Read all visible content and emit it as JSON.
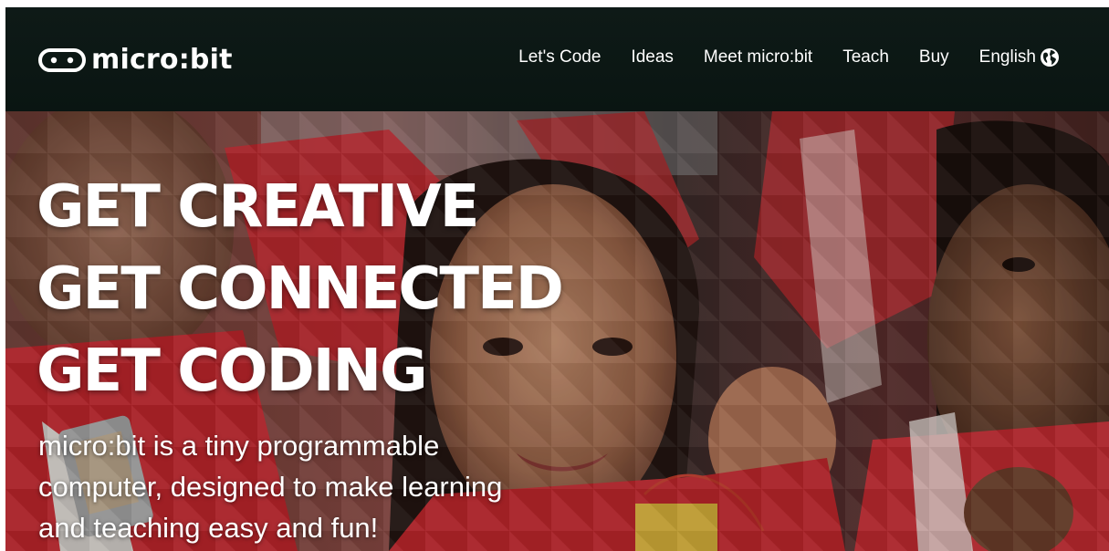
{
  "header": {
    "logo_text": "micro:bit",
    "nav": [
      {
        "label": "Let's Code"
      },
      {
        "label": "Ideas"
      },
      {
        "label": "Meet micro:bit"
      },
      {
        "label": "Teach"
      },
      {
        "label": "Buy"
      }
    ],
    "language_label": "English",
    "language_icon": "globe-icon"
  },
  "hero": {
    "headline": [
      "GET CREATIVE",
      "GET CONNECTED",
      "GET CODING"
    ],
    "subtitle": "micro:bit is a tiny programmable computer, designed to make learning and teaching easy and fun!",
    "photo": "students-wearing-micro-bit-photo"
  },
  "colors": {
    "header_bg": "#0e1a17",
    "text": "#ffffff",
    "shirt_red": "#c8242d"
  }
}
